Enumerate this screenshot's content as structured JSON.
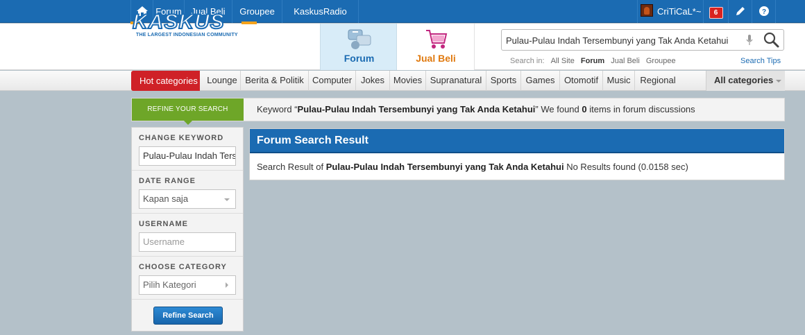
{
  "topbar": {
    "links": [
      "Forum",
      "Jual Beli",
      "Groupee",
      "KaskusRadio"
    ],
    "username": "CriTiCaL*~",
    "notification_count": "6"
  },
  "header": {
    "logo_text": "KASKUS",
    "logo_tagline": "THE LARGEST INDONESIAN COMMUNITY",
    "nav_forum": "Forum",
    "nav_jual": "Jual Beli",
    "search_value": "Pulau-Pulau Indah Tersembunyi yang Tak Anda Ketahui",
    "search_in_label": "Search in:",
    "search_scopes": [
      "All Site",
      "Forum",
      "Jual Beli",
      "Groupee"
    ],
    "active_scope": "Forum",
    "search_tips": "Search Tips"
  },
  "categories": {
    "hot": "Hot categories",
    "items": [
      "Lounge",
      "Berita & Politik",
      "Computer",
      "Jokes",
      "Movies",
      "Supranatural",
      "Sports",
      "Games",
      "Otomotif",
      "Music",
      "Regional"
    ],
    "all": "All categories"
  },
  "refine": {
    "tab": "REFINE YOUR SEARCH",
    "msg_prefix": "Keyword “",
    "msg_keyword": "Pulau-Pulau Indah Tersembunyi yang Tak Anda Ketahui",
    "msg_mid": "” We found ",
    "msg_count": "0",
    "msg_suffix": " items in forum discussions"
  },
  "sidebar": {
    "keyword_title": "CHANGE KEYWORD",
    "keyword_value": "Pulau-Pulau Indah Tersembunyi yang Tak Anda Ketahui",
    "date_title": "DATE RANGE",
    "date_value": "Kapan saja",
    "username_title": "USERNAME",
    "username_placeholder": "Username",
    "category_title": "CHOOSE CATEGORY",
    "category_value": "Pilih Kategori",
    "button": "Refine Search"
  },
  "results": {
    "title": "Forum Search Result",
    "prefix": "Search Result of ",
    "keyword": "Pulau-Pulau Indah Tersembunyi yang Tak Anda Ketahui",
    "suffix": " No Results found (0.0158 sec)"
  }
}
